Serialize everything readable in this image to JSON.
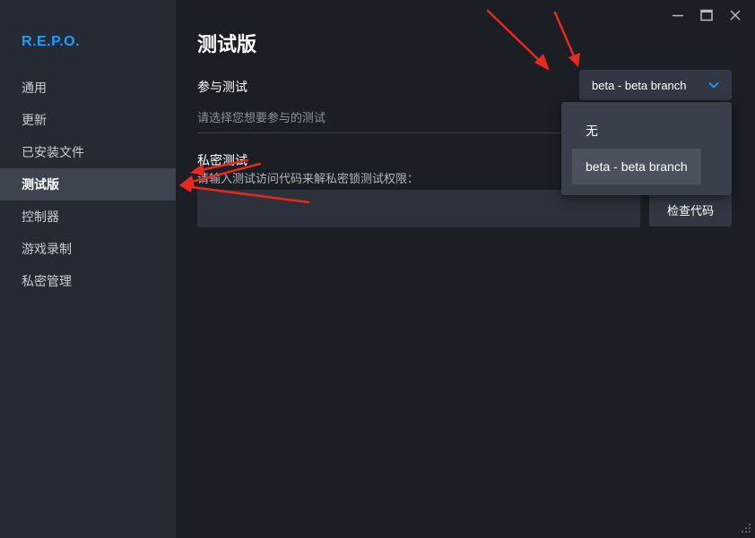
{
  "app": {
    "title": "R.E.P.O.",
    "accent": "#1a9fff"
  },
  "sidebar": {
    "items": [
      {
        "label": "通用",
        "active": false
      },
      {
        "label": "更新",
        "active": false
      },
      {
        "label": "已安装文件",
        "active": false
      },
      {
        "label": "测试版",
        "active": true
      },
      {
        "label": "控制器",
        "active": false
      },
      {
        "label": "游戏录制",
        "active": false
      },
      {
        "label": "私密管理",
        "active": false
      }
    ]
  },
  "window": {
    "icons": [
      "minimize-icon",
      "maximize-icon",
      "close-icon"
    ]
  },
  "main": {
    "title": "测试版",
    "participate": {
      "label": "参与测试",
      "hint": "请选择您想要参与的测试",
      "selected": "beta - beta branch",
      "options": [
        "无",
        "beta - beta branch"
      ]
    },
    "private": {
      "label": "私密测试",
      "hint": "请输入测试访问代码来解私密锁测试权限：",
      "input_value": "",
      "check_label": "检查代码"
    }
  },
  "annotations": {
    "arrow_color": "#e8291c"
  }
}
